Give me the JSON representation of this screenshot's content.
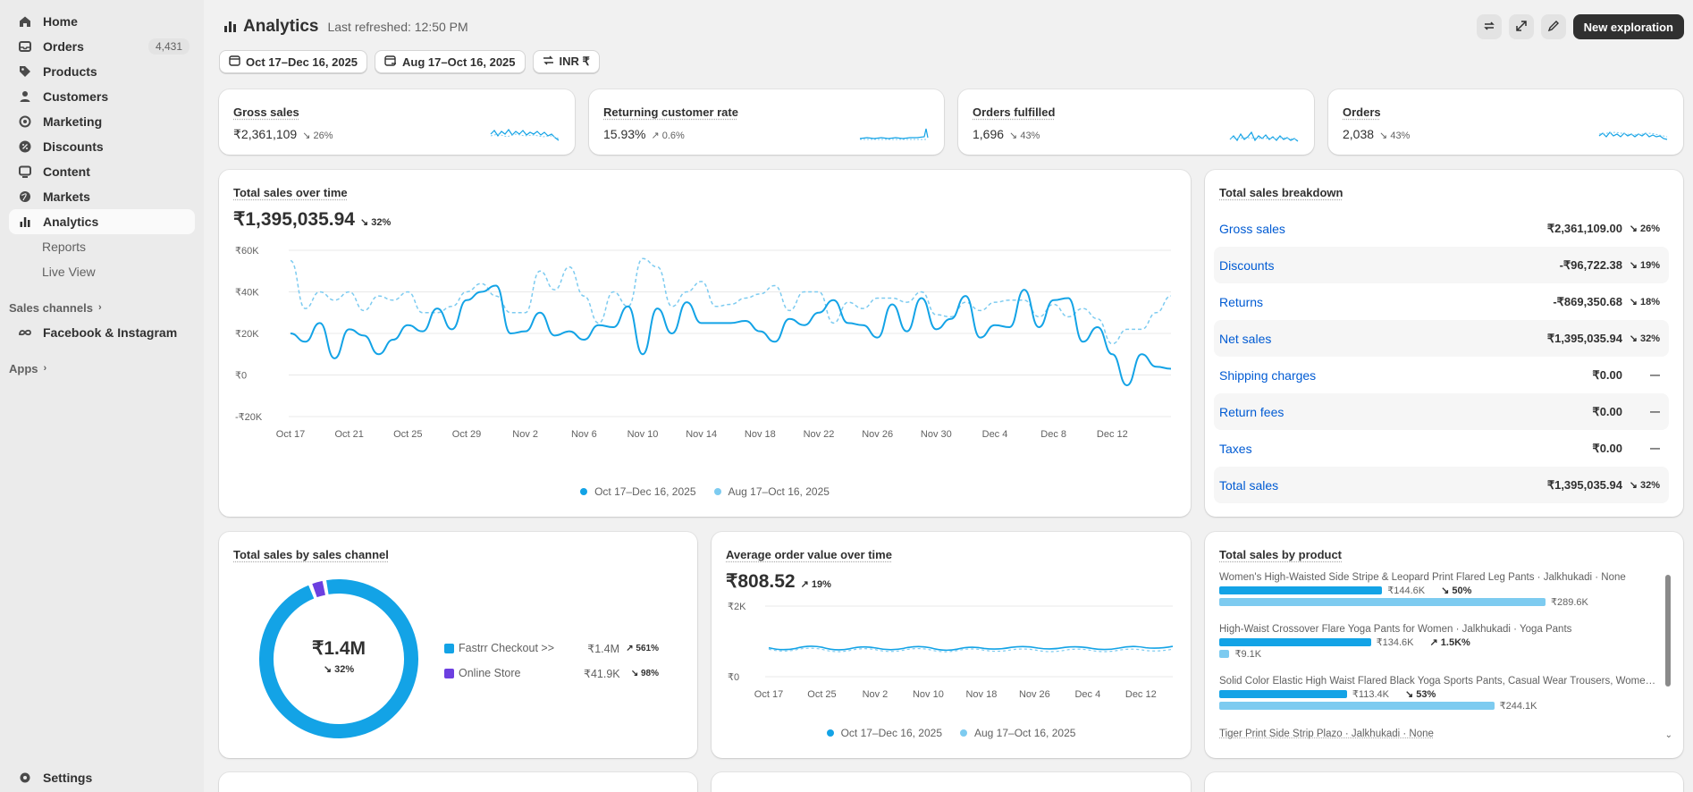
{
  "sidebar": {
    "items": [
      {
        "label": "Home",
        "icon": "home-icon"
      },
      {
        "label": "Orders",
        "icon": "orders-icon",
        "badge": "4,431"
      },
      {
        "label": "Products",
        "icon": "tag-icon"
      },
      {
        "label": "Customers",
        "icon": "person-icon"
      },
      {
        "label": "Marketing",
        "icon": "target-icon"
      },
      {
        "label": "Discounts",
        "icon": "discount-icon"
      },
      {
        "label": "Content",
        "icon": "content-icon"
      },
      {
        "label": "Markets",
        "icon": "globe-icon"
      },
      {
        "label": "Analytics",
        "icon": "bar-chart-icon"
      }
    ],
    "analytics_sub": [
      "Reports",
      "Live View"
    ],
    "sales_channels_label": "Sales channels",
    "facebook_label": "Facebook & Instagram",
    "apps_label": "Apps",
    "settings_label": "Settings"
  },
  "header": {
    "title": "Analytics",
    "refreshed": "Last refreshed: 12:50 PM",
    "new_exploration": "New exploration"
  },
  "filters": {
    "date_range": "Oct 17–Dec 16, 2025",
    "compare_range": "Aug 17–Oct 16, 2025",
    "currency": "INR ₹"
  },
  "kpis": [
    {
      "title": "Gross sales",
      "value": "₹2,361,109",
      "change": "↘ 26%"
    },
    {
      "title": "Returning customer rate",
      "value": "15.93%",
      "change": "↗ 0.6%"
    },
    {
      "title": "Orders fulfilled",
      "value": "1,696",
      "change": "↘ 43%"
    },
    {
      "title": "Orders",
      "value": "2,038",
      "change": "↘ 43%"
    }
  ],
  "total_sales_over_time": {
    "title": "Total sales over time",
    "value": "₹1,395,035.94",
    "change": "↘ 32%",
    "y_ticks": [
      "₹60K",
      "₹40K",
      "₹20K",
      "₹0",
      "-₹20K"
    ],
    "x_ticks": [
      "Oct 17",
      "Oct 21",
      "Oct 25",
      "Oct 29",
      "Nov 2",
      "Nov 6",
      "Nov 10",
      "Nov 14",
      "Nov 18",
      "Nov 22",
      "Nov 26",
      "Nov 30",
      "Dec 4",
      "Dec 8",
      "Dec 12"
    ],
    "legend": [
      "Oct 17–Dec 16, 2025",
      "Aug 17–Oct 16, 2025"
    ]
  },
  "chart_data": [
    {
      "type": "line",
      "title": "Total sales over time",
      "ylim": [
        -20000,
        60000
      ],
      "x": [
        "Oct 17",
        "Oct 18",
        "Oct 19",
        "Oct 20",
        "Oct 21",
        "Oct 22",
        "Oct 23",
        "Oct 24",
        "Oct 25",
        "Oct 26",
        "Oct 27",
        "Oct 28",
        "Oct 29",
        "Oct 30",
        "Oct 31",
        "Nov 1",
        "Nov 2",
        "Nov 3",
        "Nov 4",
        "Nov 5",
        "Nov 6",
        "Nov 7",
        "Nov 8",
        "Nov 9",
        "Nov 10",
        "Nov 11",
        "Nov 12",
        "Nov 13",
        "Nov 14",
        "Nov 15",
        "Nov 16",
        "Nov 17",
        "Nov 18",
        "Nov 19",
        "Nov 20",
        "Nov 21",
        "Nov 22",
        "Nov 23",
        "Nov 24",
        "Nov 25",
        "Nov 26",
        "Nov 27",
        "Nov 28",
        "Nov 29",
        "Nov 30",
        "Dec 1",
        "Dec 2",
        "Dec 3",
        "Dec 4",
        "Dec 5",
        "Dec 6",
        "Dec 7",
        "Dec 8",
        "Dec 9",
        "Dec 10",
        "Dec 11",
        "Dec 12",
        "Dec 13",
        "Dec 14",
        "Dec 15",
        "Dec 16"
      ],
      "series": [
        {
          "name": "Oct 17–Dec 16, 2025",
          "color": "#13a3e6",
          "style": "solid",
          "values": [
            20000,
            16000,
            25000,
            8000,
            22000,
            19000,
            10000,
            17000,
            24000,
            21000,
            32000,
            22000,
            36000,
            40000,
            43000,
            20000,
            21000,
            30000,
            19000,
            21000,
            17000,
            24000,
            23000,
            33000,
            10000,
            32000,
            20000,
            35000,
            25000,
            25000,
            25000,
            26000,
            21000,
            16000,
            27000,
            24000,
            30000,
            36000,
            25000,
            24000,
            18000,
            34000,
            21000,
            37000,
            22000,
            27000,
            38000,
            18000,
            24000,
            23000,
            41000,
            23000,
            36000,
            37000,
            16000,
            23000,
            10000,
            -5000,
            10000,
            4000,
            3000
          ]
        },
        {
          "name": "Aug 17–Oct 16, 2025",
          "color": "#7dcbf0",
          "style": "dashed",
          "values": [
            55000,
            32000,
            40000,
            36000,
            40000,
            31000,
            38000,
            36000,
            40000,
            30000,
            30000,
            33000,
            40000,
            44000,
            38000,
            30000,
            30000,
            50000,
            41000,
            52000,
            38000,
            25000,
            40000,
            33000,
            56000,
            52000,
            33000,
            40000,
            45000,
            33000,
            34000,
            37000,
            39000,
            43000,
            31000,
            40000,
            40000,
            25000,
            35000,
            32000,
            37000,
            37000,
            35000,
            40000,
            29000,
            28000,
            35000,
            31000,
            35000,
            36000,
            36000,
            28000,
            34000,
            28000,
            32000,
            27000,
            15000,
            22000,
            22000,
            30000,
            38000
          ]
        }
      ]
    },
    {
      "type": "pie",
      "title": "Total sales by sales channel",
      "categories": [
        "Fastrr Checkout >>",
        "Online Store"
      ],
      "values": [
        1400000,
        41900
      ]
    },
    {
      "type": "line",
      "title": "Average order value over time",
      "ylim": [
        0,
        2000
      ],
      "x": [
        "Oct 17",
        "Oct 21",
        "Oct 25",
        "Oct 29",
        "Nov 2",
        "Nov 6",
        "Nov 10",
        "Nov 14",
        "Nov 18",
        "Nov 22",
        "Nov 26",
        "Nov 30",
        "Dec 4",
        "Dec 8",
        "Dec 12",
        "Dec 16"
      ],
      "series": [
        {
          "name": "Oct 17–Dec 16, 2025",
          "color": "#13a3e6",
          "values": [
            820,
            800,
            830,
            790,
            810,
            800,
            820,
            780,
            800,
            830,
            810,
            830,
            800,
            810,
            820,
            860
          ]
        },
        {
          "name": "Aug 17–Oct 16, 2025",
          "color": "#7dcbf0",
          "values": [
            780,
            760,
            770,
            740,
            760,
            750,
            760,
            740,
            750,
            760,
            740,
            750,
            740,
            750,
            740,
            780
          ]
        }
      ]
    },
    {
      "type": "bar",
      "title": "Total sales by product",
      "categories": [
        "Women's High-Waisted Side Stripe & Leopard Print Flared Leg Pants · Jalkhukadi · None",
        "High-Waist Crossover Flare Yoga Pants for Women · Jalkhukadi · Yoga Pants",
        "Solid Color Elastic High Waist Flared Black Yoga Sports Pants, Casual Wear Trousers, Women'..."
      ],
      "series": [
        {
          "name": "Oct 17–Dec 16, 2025",
          "values": [
            144600,
            134600,
            113400
          ]
        },
        {
          "name": "Aug 17–Oct 16, 2025",
          "values": [
            289600,
            9100,
            244100
          ]
        }
      ]
    }
  ],
  "breakdown": {
    "title": "Total sales breakdown",
    "rows": [
      {
        "name": "Gross sales",
        "value": "₹2,361,109.00",
        "change": "↘ 26%"
      },
      {
        "name": "Discounts",
        "value": "-₹96,722.38",
        "change": "↘ 19%"
      },
      {
        "name": "Returns",
        "value": "-₹869,350.68",
        "change": "↘ 18%"
      },
      {
        "name": "Net sales",
        "value": "₹1,395,035.94",
        "change": "↘ 32%"
      },
      {
        "name": "Shipping charges",
        "value": "₹0.00",
        "change": "—"
      },
      {
        "name": "Return fees",
        "value": "₹0.00",
        "change": "—"
      },
      {
        "name": "Taxes",
        "value": "₹0.00",
        "change": "—"
      },
      {
        "name": "Total sales",
        "value": "₹1,395,035.94",
        "change": "↘ 32%"
      }
    ]
  },
  "channel": {
    "title": "Total sales by sales channel",
    "center_value": "₹1.4M",
    "center_change": "↘ 32%",
    "items": [
      {
        "name": "Fastrr Checkout >>",
        "value": "₹1.4M",
        "change": "↗ 561%",
        "color": "#13a3e6"
      },
      {
        "name": "Online Store",
        "value": "₹41.9K",
        "change": "↘ 98%",
        "color": "#6c3fe0"
      }
    ]
  },
  "aov": {
    "title": "Average order value over time",
    "value": "₹808.52",
    "change": "↗ 19%",
    "y_ticks": [
      "₹2K",
      "₹0"
    ],
    "x_ticks": [
      "Oct 17",
      "Oct 25",
      "Nov 2",
      "Nov 10",
      "Nov 18",
      "Nov 26",
      "Dec 4",
      "Dec 12"
    ],
    "legend": [
      "Oct 17–Dec 16, 2025",
      "Aug 17–Oct 16, 2025"
    ]
  },
  "products": {
    "title": "Total sales by product",
    "items": [
      {
        "name": "Women's High-Waisted Side Stripe & Leopard Print Flared Leg Pants · Jalkhukadi · None",
        "cur": "₹144.6K",
        "change": "↘ 50%",
        "prev": "₹289.6K"
      },
      {
        "name": "High-Waist Crossover Flare Yoga Pants for Women · Jalkhukadi · Yoga Pants",
        "cur": "₹134.6K",
        "change": "↗ 1.5K%",
        "prev": "₹9.1K"
      },
      {
        "name": "Solid Color Elastic High Waist Flared Black Yoga Sports Pants, Casual Wear Trousers, Women'...",
        "cur": "₹113.4K",
        "change": "↘ 53%",
        "prev": "₹244.1K"
      }
    ],
    "last_item": "Tiger Print Side Strip Plazo · Jalkhukadi · None"
  }
}
